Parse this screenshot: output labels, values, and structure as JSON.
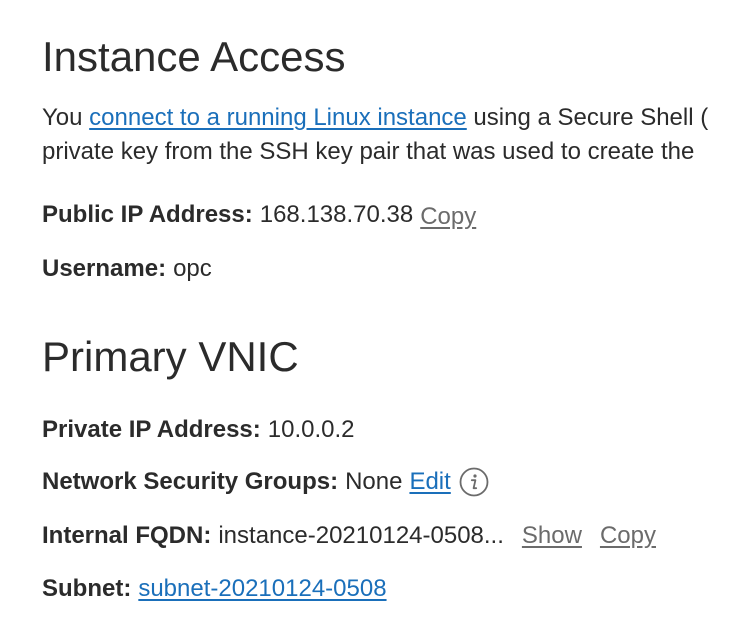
{
  "instance_access": {
    "title": "Instance Access",
    "intro_line1_before": "You ",
    "intro_link": "connect to a running Linux instance",
    "intro_line1_after": " using a Secure Shell (",
    "intro_line2": "private key from the SSH key pair that was used to create the"
  },
  "public_ip": {
    "label": "Public IP Address:",
    "value": "168.138.70.38",
    "copy_label": "Copy"
  },
  "username": {
    "label": "Username:",
    "value": "opc"
  },
  "primary_vnic": {
    "title": "Primary VNIC"
  },
  "private_ip": {
    "label": "Private IP Address:",
    "value": "10.0.0.2"
  },
  "nsg": {
    "label": "Network Security Groups:",
    "value": "None",
    "edit_label": "Edit",
    "info_icon": "info-icon"
  },
  "fqdn": {
    "label": "Internal FQDN:",
    "value": "instance-20210124-0508...",
    "show_label": "Show",
    "copy_label": "Copy"
  },
  "subnet": {
    "label": "Subnet:",
    "value": "subnet-20210124-0508"
  },
  "colors": {
    "link": "#1a6fba",
    "action": "#6b6b6b",
    "text": "#2b2b2b"
  }
}
